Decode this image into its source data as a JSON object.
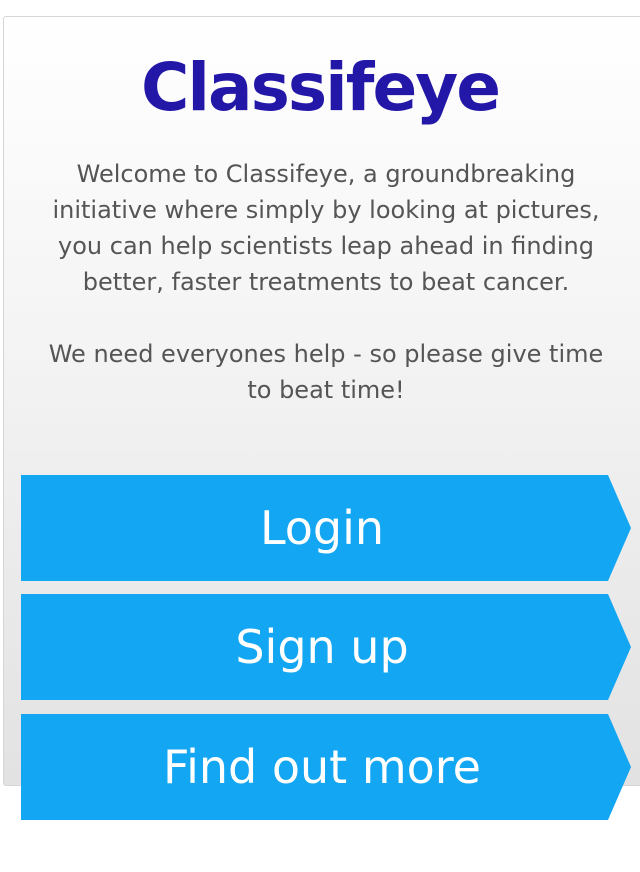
{
  "app": {
    "logo_text": "Classifeye",
    "brand_color": "#2317a8"
  },
  "intro": {
    "welcome": "Welcome to Classifeye, a groundbreaking initiative where simply by looking at pictures, you can help scientists leap ahead in finding better, faster treatments to beat cancer.",
    "appeal": "We need everyones help - so please give time to beat time!"
  },
  "buttons": {
    "login": "Login",
    "signup": "Sign up",
    "find_out_more": "Find out more",
    "color": "#13a6f2"
  }
}
